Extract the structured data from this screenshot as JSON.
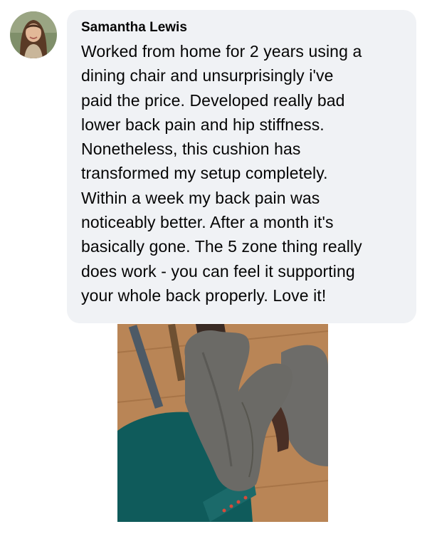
{
  "comment": {
    "author_name": "Samantha Lewis",
    "text": "Worked from home for 2 years using a\ndining chair and unsurprisingly i've\npaid the price. Developed really bad\nlower back pain and hip stiffness.\nNonetheless, this cushion has\ntransformed my setup completely.\nWithin a week my back pain was\nnoticeably better. After a month it's\nbasically gone. The 5 zone thing really\ndoes work - you can feel it supporting\nyour whole back properly. Love it!",
    "avatar_icon": "user-profile-photo",
    "photo_icon": "lumbar-cushion-on-chair-photo"
  },
  "colors": {
    "bubble_bg": "#f0f2f5",
    "text": "#050505"
  }
}
